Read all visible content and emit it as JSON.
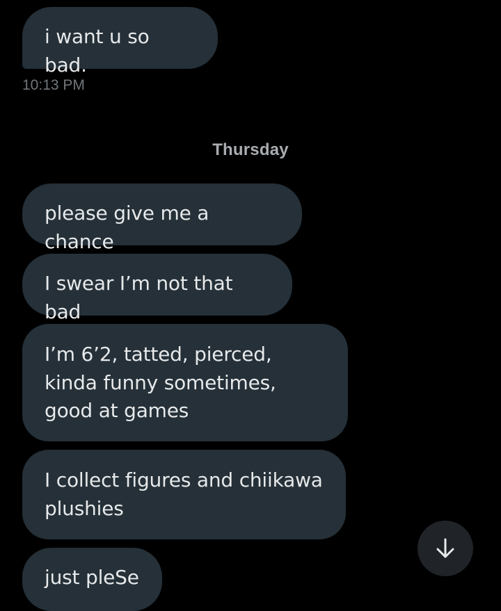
{
  "messages": [
    {
      "text": "i want u so bad."
    },
    {
      "text": "please give me a chance"
    },
    {
      "text": "I swear I’m not that bad"
    },
    {
      "text": "I’m 6’2, tatted, pierced, kinda funny sometimes, good at games"
    },
    {
      "text": "I collect figures and chiikawa plushies"
    },
    {
      "text": "just pleSe"
    }
  ],
  "timestamp": "10:13 PM",
  "day_separator": "Thursday",
  "scroll_button": {
    "icon": "arrow-down-icon"
  },
  "colors": {
    "background": "#000000",
    "bubble": "#253038",
    "text": "#e7e9ea",
    "muted": "#71767b",
    "scroll_button": "#202327"
  }
}
